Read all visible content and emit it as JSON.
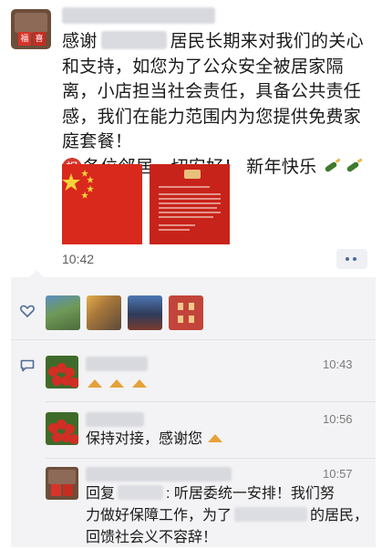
{
  "post": {
    "line1_a": "感谢",
    "line1_b": "居民长期来对我们的关心",
    "line2": "和支持，如您为了公众安全被居家隔",
    "line3": "离，小店担当社会责任，具备公共责任",
    "line4": "感，我们在能力范围内为您提供免费家",
    "line5": "庭套餐！",
    "zhu": "祝",
    "line6": "各位邻居一切安好！ 新年快乐",
    "time": "10:42"
  },
  "image_tiles": {
    "tile1_icon": "china-flag-image",
    "tile2_icon": "red-notice-image"
  },
  "comments": [
    {
      "time": "10:43",
      "text": ""
    },
    {
      "time": "10:56",
      "text": "保持对接，感谢您"
    },
    {
      "time": "10:57",
      "line1": "回复",
      "line1_b": ": 听居委统一安排！我们努",
      "line2_a": "力做好保障工作，为了",
      "line2_b": "的居民，",
      "line3": "回馈社会义不容辞！"
    }
  ],
  "colors": {
    "flag_red": "#d9291c",
    "panel_bg": "#f3f3f5",
    "link_blue": "#4e6a97"
  }
}
